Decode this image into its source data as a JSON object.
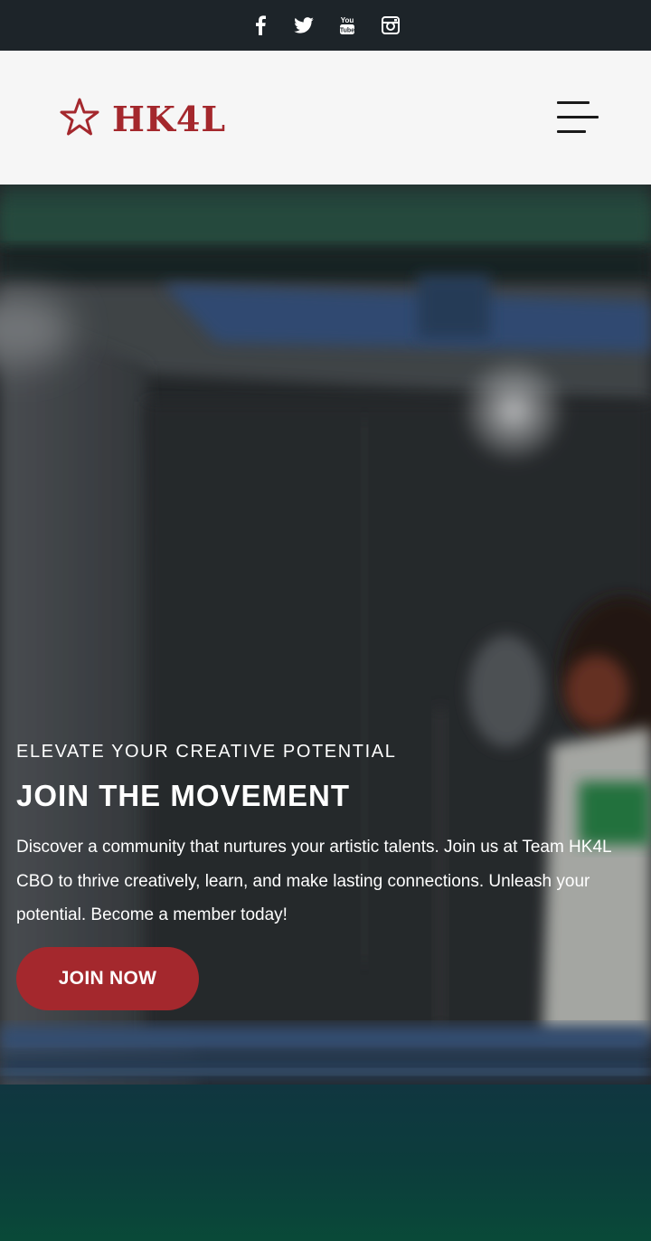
{
  "social": {
    "icons": [
      "facebook-icon",
      "twitter-icon",
      "youtube-icon",
      "instagram-icon"
    ]
  },
  "header": {
    "logo_text": "HK4L",
    "logo_icon": "star-outline-icon",
    "menu_icon": "hamburger-menu-icon"
  },
  "hero": {
    "eyebrow": "ELEVATE YOUR CREATIVE POTENTIAL",
    "headline": "JOIN THE MOVEMENT",
    "description": "Discover a community that nurtures your artistic talents. Join us at Team HK4L CBO to thrive creatively, learn, and make lasting connections. Unleash your potential. Become a member today!",
    "cta_label": "JOIN NOW"
  },
  "colors": {
    "brand_red": "#a4282d",
    "top_bar": "#1d2429",
    "header_bg": "#f6f6f6",
    "hero_text": "#ffffff"
  }
}
